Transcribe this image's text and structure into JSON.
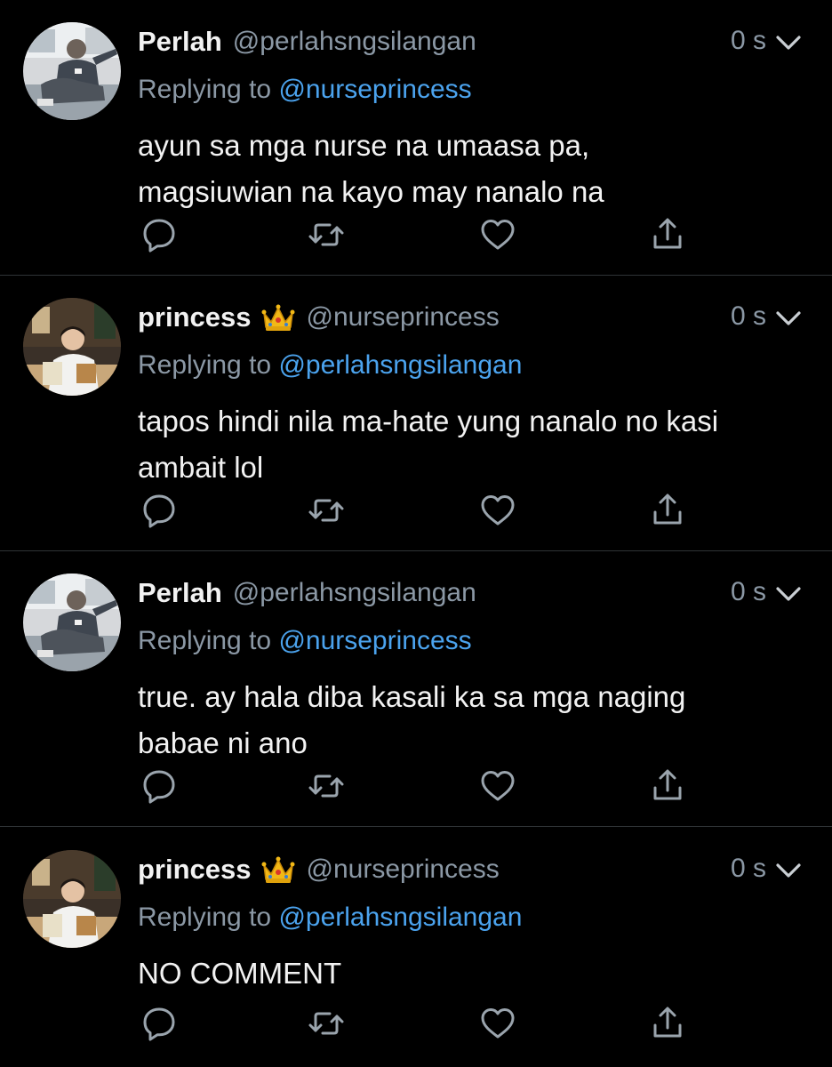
{
  "tweets": [
    {
      "display_name": "Perlah",
      "has_crown": false,
      "handle": "@perlahsngsilangan",
      "time": "0 s",
      "replying_prefix": "Replying to ",
      "replying_to": "@nurseprincess",
      "text_lines": [
        "ayun sa mga nurse na umaasa pa,",
        "magsiuwian na kayo may nanalo na"
      ],
      "avatar": "perlah"
    },
    {
      "display_name": "princess",
      "has_crown": true,
      "handle": "@nurseprincess",
      "time": "0 s",
      "replying_prefix": "Replying to ",
      "replying_to": "@perlahsngsilangan",
      "text_lines": [
        "tapos hindi nila ma-hate yung nanalo no kasi",
        "ambait lol"
      ],
      "avatar": "princess"
    },
    {
      "display_name": "Perlah",
      "has_crown": false,
      "handle": "@perlahsngsilangan",
      "time": "0 s",
      "replying_prefix": "Replying to ",
      "replying_to": "@nurseprincess",
      "text_lines": [
        "true. ay hala diba kasali ka sa mga naging",
        "babae ni ano"
      ],
      "avatar": "perlah"
    },
    {
      "display_name": "princess",
      "has_crown": true,
      "handle": "@nurseprincess",
      "time": "0 s",
      "replying_prefix": "Replying to ",
      "replying_to": "@perlahsngsilangan",
      "text_lines": [
        "NO COMMENT"
      ],
      "avatar": "princess"
    }
  ],
  "icons": {
    "reply": "reply-icon",
    "retweet": "retweet-icon",
    "like": "like-icon",
    "share": "share-icon",
    "caret": "chevron-down-icon",
    "crown": "crown-emoji"
  },
  "colors": {
    "background": "#000000",
    "text": "#f2f2f2",
    "muted": "#8b98a5",
    "link": "#4ba3ee",
    "divider": "#2f3336"
  }
}
